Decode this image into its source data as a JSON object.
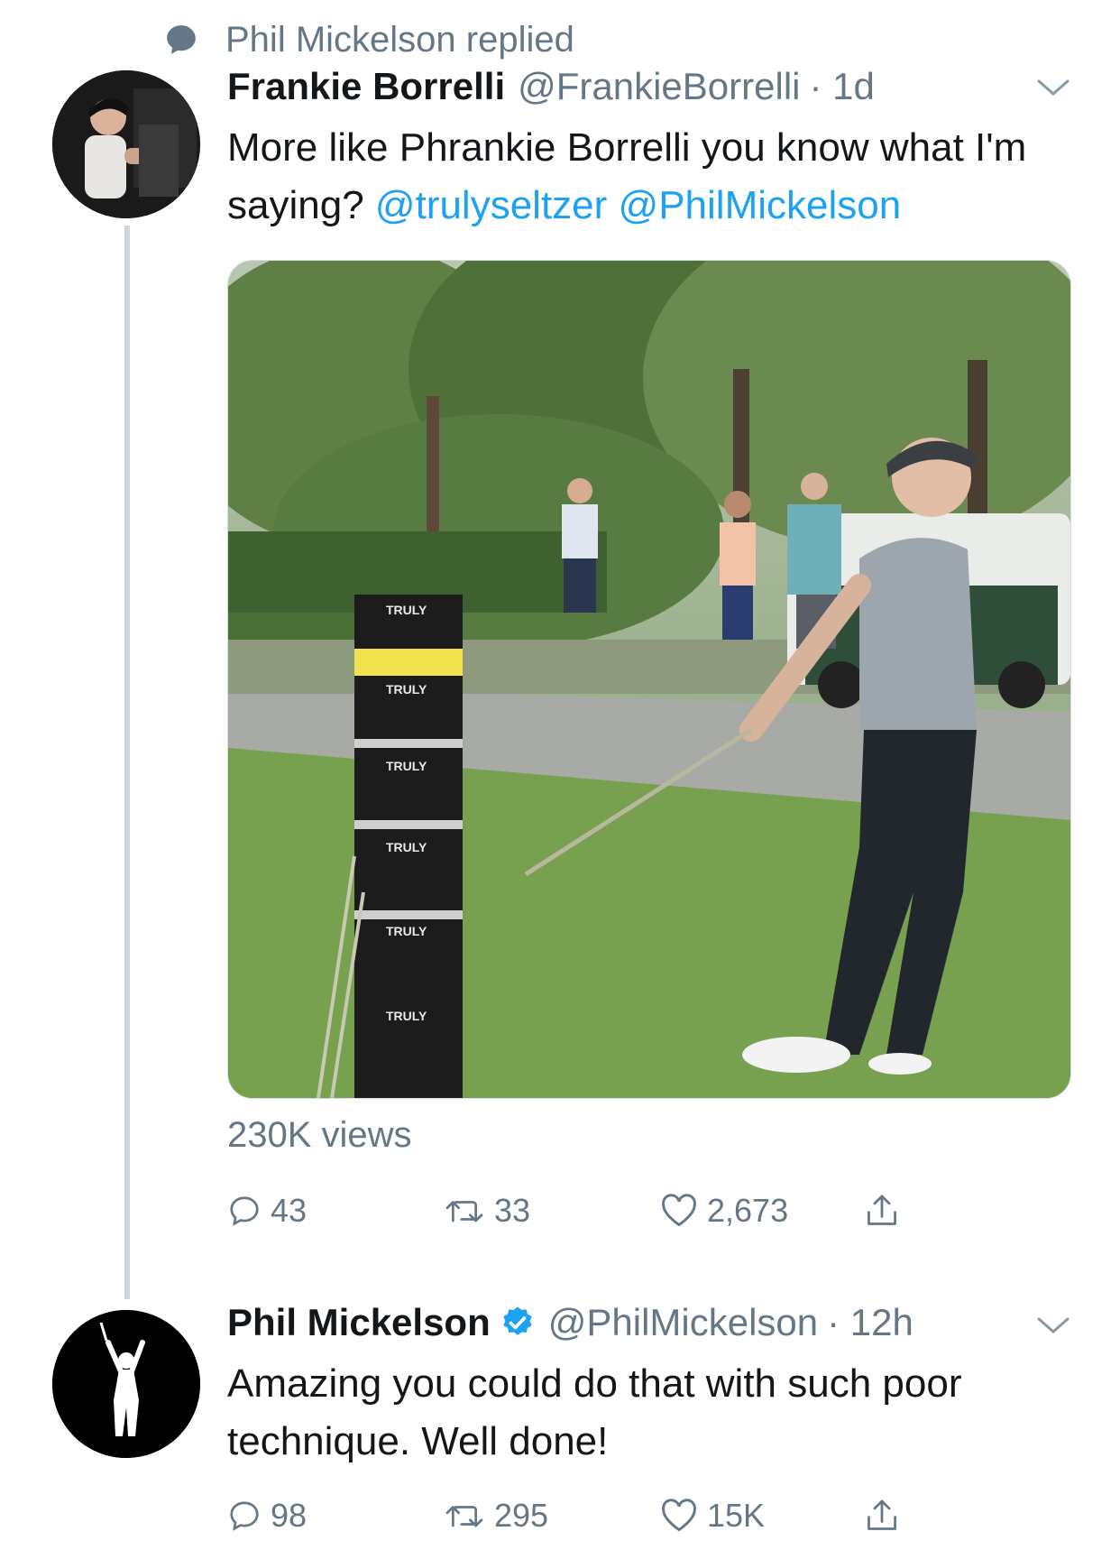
{
  "context": {
    "text": "Phil Mickelson replied",
    "icon": "speech-bubble-icon"
  },
  "tweet1": {
    "name": "Frankie Borrelli",
    "handle": "@FrankieBorrelli",
    "time": "· 1d",
    "text_plain": "More like Phrankie Borrelli you know what I'm saying?",
    "mention1": "@trulyseltzer",
    "mention2": "@PhilMickelson",
    "views": "230K views",
    "replies": "43",
    "retweets": "33",
    "likes": "2,673",
    "media_boxes": [
      "TRULY",
      "TRULY",
      "TRULY",
      "TRULY",
      "TRULY",
      "TRULY"
    ]
  },
  "tweet2": {
    "name": "Phil Mickelson",
    "handle": "@PhilMickelson",
    "time": "· 12h",
    "text": "Amazing you could do that with such poor technique. Well done!",
    "replies": "98",
    "retweets": "295",
    "likes": "15K"
  },
  "colors": {
    "link": "#1da1f2",
    "secondary": "#657786",
    "thread_line": "#ccd6dd",
    "verified": "#1da1f2"
  }
}
